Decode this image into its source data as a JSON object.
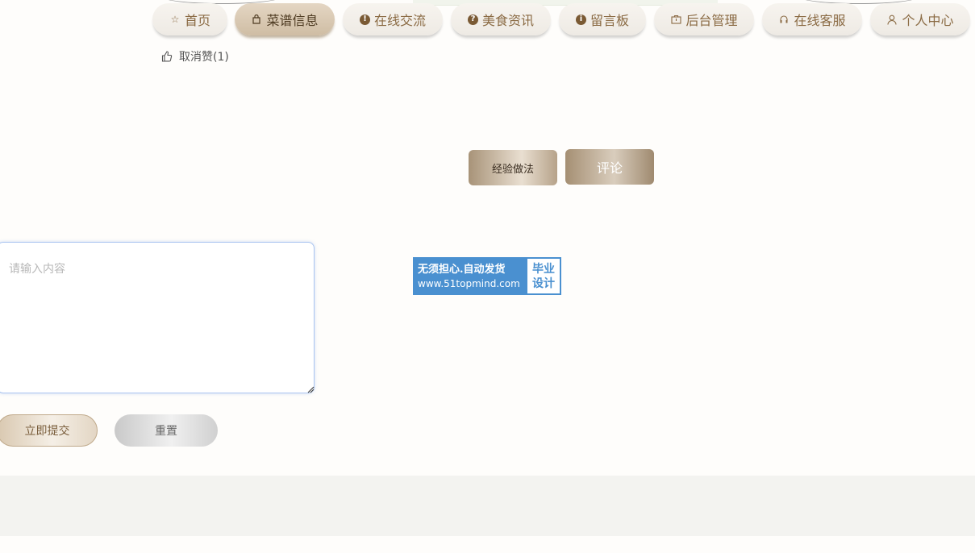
{
  "nav": {
    "items": [
      {
        "label": "首页",
        "icon": "star-icon"
      },
      {
        "label": "菜谱信息",
        "icon": "bag-icon"
      },
      {
        "label": "在线交流",
        "icon": "exclamation-circle-icon"
      },
      {
        "label": "美食资讯",
        "icon": "question-circle-icon"
      },
      {
        "label": "留言板",
        "icon": "info-circle-icon"
      },
      {
        "label": "后台管理",
        "icon": "briefcase-icon"
      },
      {
        "label": "在线客服",
        "icon": "headset-icon"
      },
      {
        "label": "个人中心",
        "icon": "user-icon"
      }
    ],
    "active": "菜谱信息"
  },
  "like": {
    "label": "取消赞(1)",
    "icon": "thumb-up-icon"
  },
  "tabs": {
    "method": "经验做法",
    "comment": "评论"
  },
  "comment_form": {
    "placeholder": "请输入内容",
    "submit_label": "立即提交",
    "reset_label": "重置"
  },
  "watermark": {
    "line1": "无须担心.自动发货",
    "line2": "www.51topmind.com",
    "badge_line1": "毕业",
    "badge_line2": "设计"
  },
  "colors": {
    "accent": "#8a6a43",
    "watermark_blue": "#4a90d0",
    "footer_bg": "#f3f3f0"
  }
}
